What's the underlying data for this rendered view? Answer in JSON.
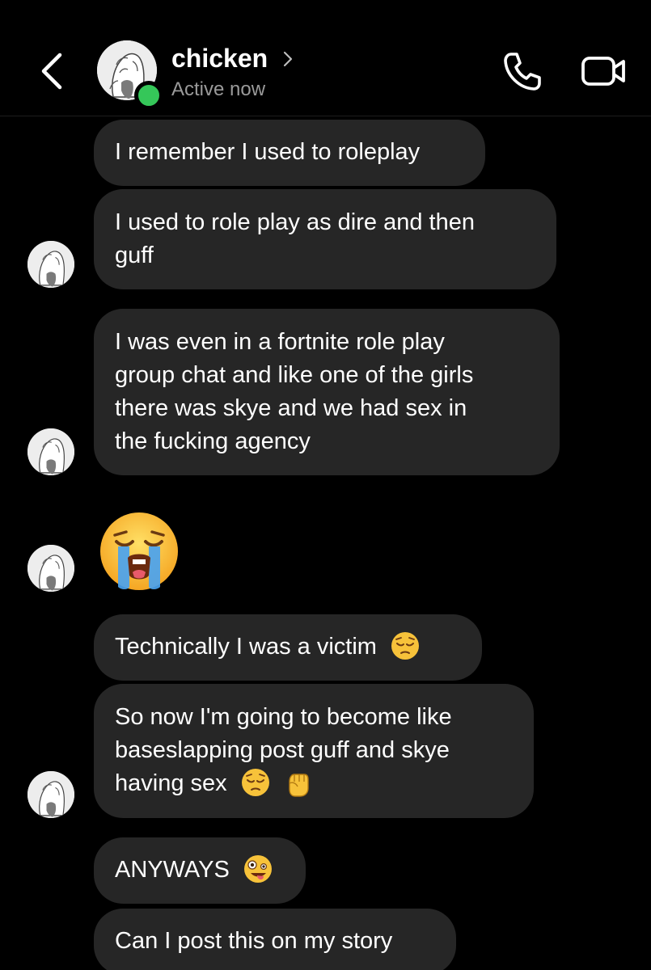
{
  "header": {
    "contact_name": "chicken",
    "status": "Active now",
    "accent_online": "#35c759"
  },
  "icons": {
    "back": "chevron-left-icon",
    "phone": "phone-icon",
    "video": "video-camera-icon",
    "name_more": "chevron-right-icon"
  },
  "messages": [
    {
      "lines": [
        "I remember I used to roleplay"
      ]
    },
    {
      "lines": [
        "I used to role play as dire and then",
        "guff"
      ]
    },
    {
      "lines": [
        "I was even in a fortnite role play",
        "group chat and like one of the girls",
        "there was skye and we had sex in",
        "the fucking agency"
      ]
    },
    {
      "emoji": "loudly-crying-face"
    },
    {
      "lines": [
        "Technically I was a victim"
      ],
      "emoji": [
        "pensive-face"
      ]
    },
    {
      "lines": [
        "So now I'm going to become like",
        "baseslapping post guff and skye",
        "having sex"
      ],
      "emoji": [
        "pensive-face",
        "raised-fist"
      ]
    },
    {
      "lines": [
        "ANYWAYS"
      ],
      "emoji": [
        "zany-face"
      ]
    },
    {
      "lines": [
        "Can I post this on my story"
      ]
    }
  ],
  "colors": {
    "background": "#000000",
    "bubble": "#262626",
    "text": "#ffffff",
    "status_text": "#9a9a9a"
  }
}
